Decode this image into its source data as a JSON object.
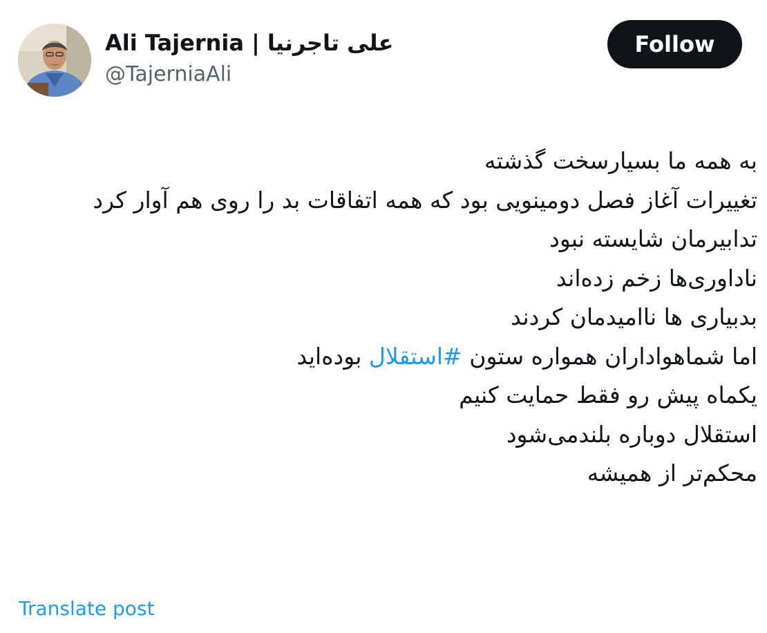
{
  "author": {
    "display_name": "Ali Tajernia | علی تاجرنیا",
    "handle": "@TajerniaAli",
    "avatar_icon": "profile-photo"
  },
  "actions": {
    "follow_label": "Follow",
    "translate_label": "Translate post"
  },
  "post": {
    "lines": [
      "به همه ما بسیارسخت گذشته",
      "تغییرات آغاز فصل دومینویی بود که همه اتفاقات بد را روی هم آوار کرد",
      "تدابیرمان شایسته نبود",
      "ناداوری‌ها زخم زده‌اند",
      "بدبیاری ها ناامیدمان کردند",
      "یکماه پیش رو فقط حمایت کنیم",
      "استقلال دوباره بلندمی‌شود",
      "محکم‌تر از همیشه"
    ],
    "hashtag_line": {
      "before": "اما شماهواداران همواره ستون ",
      "hashtag": "#استقلال",
      "after": " بوده‌اید"
    }
  },
  "colors": {
    "text": "#0f1419",
    "secondary": "#536471",
    "link": "#1d9bf0",
    "button_bg": "#0f1419",
    "button_text": "#ffffff"
  }
}
